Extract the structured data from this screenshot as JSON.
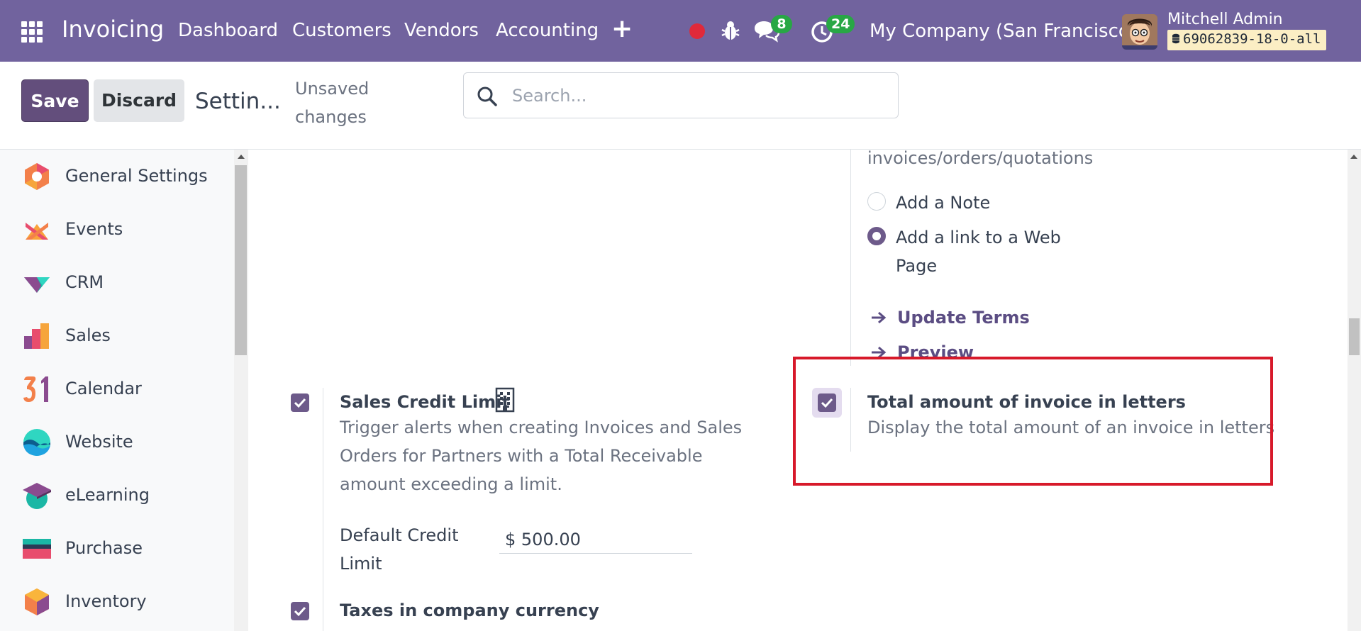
{
  "navbar": {
    "app_name": "Invoicing",
    "menu": [
      "Dashboard",
      "Customers",
      "Vendors",
      "Accounting"
    ],
    "plus_label": "+",
    "messages_count": "8",
    "activities_count": "24",
    "company": "My Company (San Francisco)",
    "user_name": "Mitchell Admin",
    "database": "69062839-18-0-all",
    "colors": {
      "navbar": "#71639e",
      "badge": "#28a745",
      "record": "#e0293a"
    }
  },
  "control_panel": {
    "save_label": "Save",
    "discard_label": "Discard",
    "breadcrumb": "Settin...",
    "unsaved_status": "Unsaved changes",
    "search_placeholder": "Search..."
  },
  "sidebar": {
    "items": [
      {
        "label": "General Settings",
        "icon": "general-settings-icon"
      },
      {
        "label": "Events",
        "icon": "events-icon"
      },
      {
        "label": "CRM",
        "icon": "crm-icon"
      },
      {
        "label": "Sales",
        "icon": "sales-icon"
      },
      {
        "label": "Calendar",
        "icon": "calendar-icon"
      },
      {
        "label": "Website",
        "icon": "website-icon"
      },
      {
        "label": "eLearning",
        "icon": "elearning-icon"
      },
      {
        "label": "Purchase",
        "icon": "purchase-icon"
      },
      {
        "label": "Inventory",
        "icon": "inventory-icon"
      }
    ]
  },
  "settings": {
    "terms_partial_text": "invoices/orders/quotations",
    "terms_options": [
      {
        "label": "Add a Note",
        "selected": false
      },
      {
        "label": "Add a link to a Web Page",
        "selected": true
      }
    ],
    "update_terms_label": "Update Terms",
    "preview_label": "Preview",
    "sales_credit_limit": {
      "checked": true,
      "title": "Sales Credit Limit",
      "description": "Trigger alerts when creating Invoices and Sales Orders for Partners with a Total Receivable amount exceeding a limit.",
      "default_credit_label": "Default Credit Limit",
      "default_credit_value": "$ 500.00"
    },
    "total_in_letters": {
      "checked": true,
      "title": "Total amount of invoice in letters",
      "description": "Display the total amount of an invoice in letters"
    },
    "taxes_company_currency": {
      "checked": true,
      "title": "Taxes in company currency"
    }
  }
}
